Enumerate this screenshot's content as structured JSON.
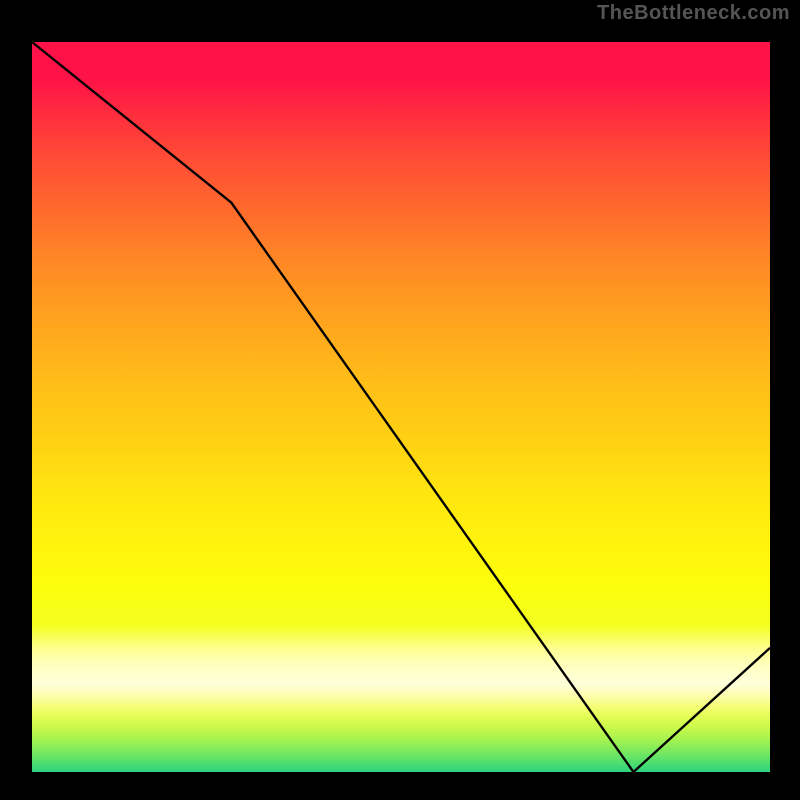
{
  "watermark": "TheBottleneck.com",
  "chart_data": {
    "type": "line",
    "title": "",
    "xlabel": "",
    "ylabel": "",
    "xlim": [
      0,
      1000
    ],
    "ylim": [
      0,
      1000
    ],
    "grid": false,
    "legend": false,
    "series": [
      {
        "name": "bottleneck-curve",
        "x": [
          0,
          270,
          815,
          1000
        ],
        "y": [
          1000,
          780,
          0,
          170
        ]
      }
    ],
    "annotations": [
      {
        "text": "",
        "x": 806,
        "y": 3,
        "color": "#C7361F",
        "role": "minimum-marker"
      }
    ],
    "background_gradient": {
      "top": "#FF1247",
      "mid": "#FFE60F",
      "bottom": "#2CD37E",
      "meaning": "red-high-bottleneck-to-green-low-bottleneck"
    }
  },
  "colors": {
    "frame": "#000000",
    "curve": "#000000",
    "watermark": "#555555",
    "annotation": "#C7361F"
  }
}
